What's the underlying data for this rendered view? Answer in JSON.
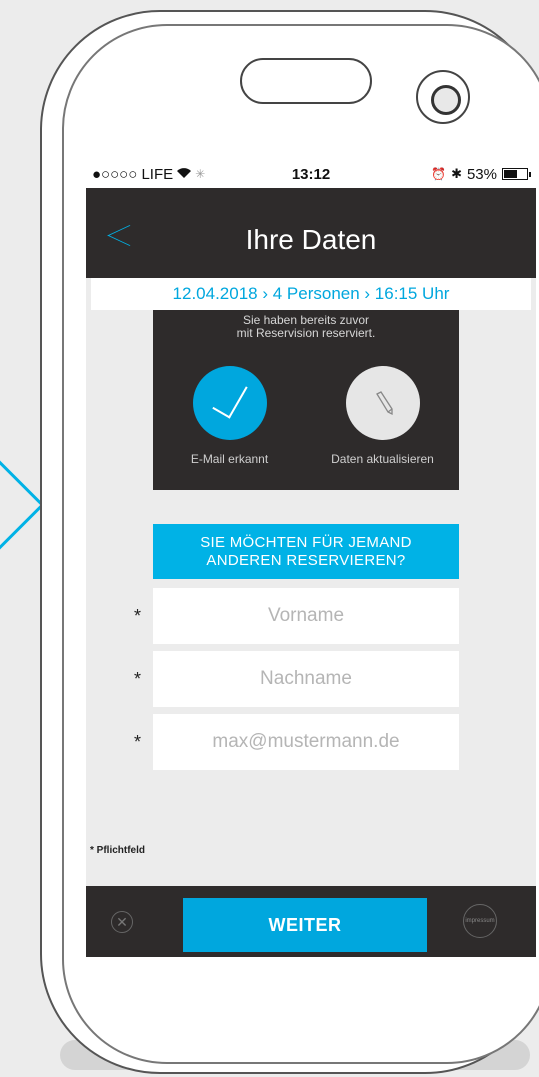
{
  "status_bar": {
    "carrier": "●○○○○ LIFE",
    "time": "13:12",
    "battery": "53%"
  },
  "header": {
    "title": "Ihre Daten"
  },
  "summary": {
    "text": "12.04.2018 › 4 Personen › 16:15 Uhr"
  },
  "recognition": {
    "line1": "Sie haben bereits zuvor",
    "line2": "mit Reservision reserviert.",
    "email_label": "E-Mail erkannt",
    "update_label": "Daten aktualisieren"
  },
  "alt_reserve": {
    "line1": "SIE MÖCHTEN FÜR JEMAND",
    "line2": "ANDEREN RESERVIEREN?"
  },
  "form": {
    "first_name": {
      "star": "*",
      "placeholder": "Vorname"
    },
    "last_name": {
      "star": "*",
      "placeholder": "Nachname"
    },
    "email": {
      "star": "*",
      "placeholder": "max@mustermann.de"
    },
    "required_note": "* Pflichtfeld"
  },
  "footer": {
    "next_label": "WEITER",
    "impressum_label": "impressum"
  },
  "colors": {
    "accent": "#00a7de",
    "dark": "#2e2b2b",
    "background": "#ececec"
  }
}
